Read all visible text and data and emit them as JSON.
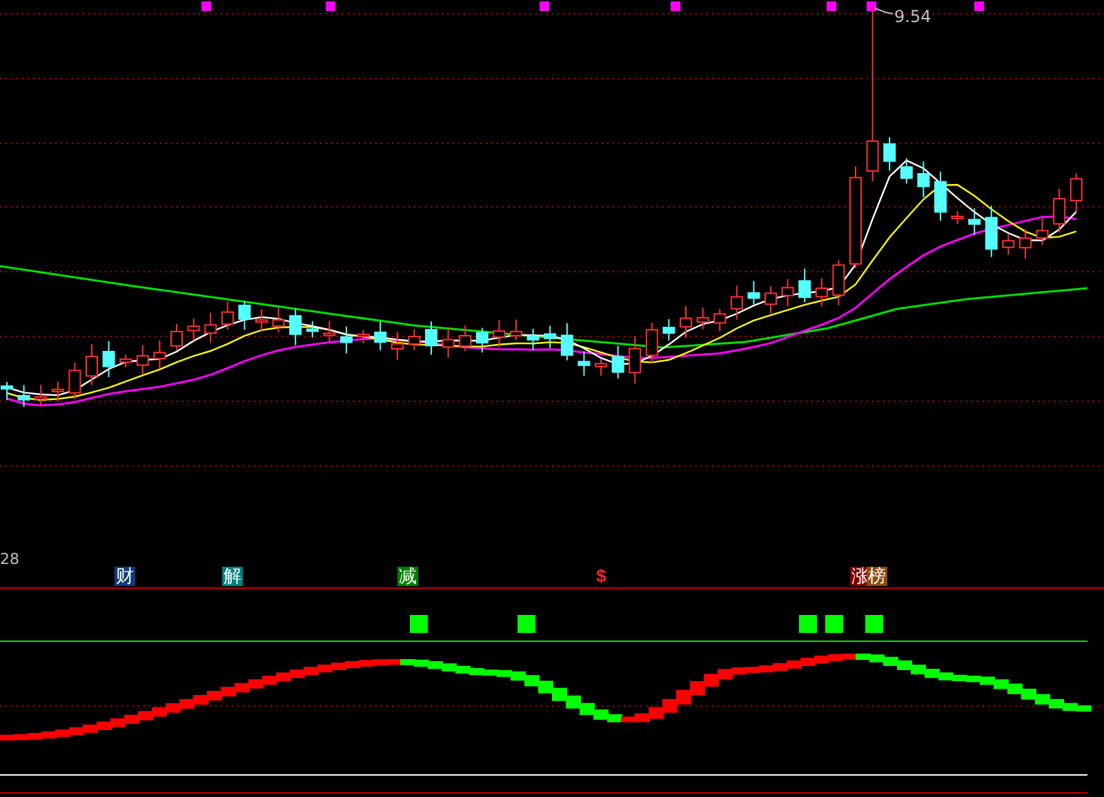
{
  "price_chart": {
    "high_label": "9.54"
  },
  "indicator_panel": {
    "scale_label": "28",
    "markers": [
      {
        "kind": "badge",
        "text": "财",
        "color": "#0b3d7a"
      },
      {
        "kind": "badge",
        "text": "解",
        "color": "#008080"
      },
      {
        "kind": "badge",
        "text": "减",
        "color": "#008000"
      },
      {
        "kind": "symbol",
        "text": "$",
        "color": "#ff2020"
      },
      {
        "kind": "badge",
        "text": "涨",
        "color": "#800000"
      },
      {
        "kind": "badge",
        "text": "榜",
        "color": "#8b4a10"
      }
    ]
  }
}
